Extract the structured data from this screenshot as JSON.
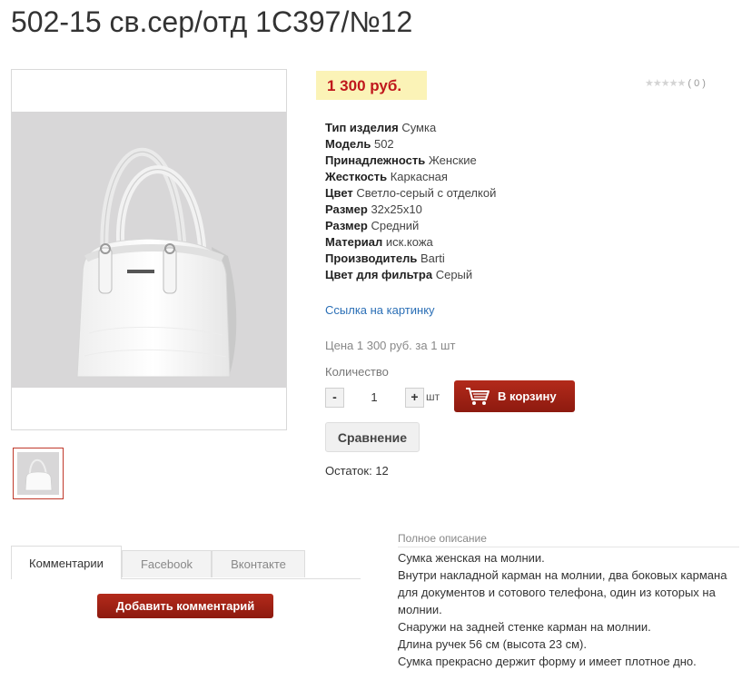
{
  "product": {
    "title": "502-15 св.сер/отд 1С397/№12",
    "price": "1 300 руб.",
    "rating": {
      "value": 0,
      "max": 5,
      "count_text": "( 0 )"
    },
    "properties": [
      {
        "name": "Тип изделия",
        "value": "Сумка"
      },
      {
        "name": "Модель",
        "value": "502"
      },
      {
        "name": "Принадлежность",
        "value": "Женские"
      },
      {
        "name": "Жесткость",
        "value": "Каркасная"
      },
      {
        "name": "Цвет",
        "value": "Светло-серый с отделкой"
      },
      {
        "name": "Размер",
        "value": "32x25x10"
      },
      {
        "name": "Размер",
        "value": "Средний"
      },
      {
        "name": "Материал",
        "value": "иск.кожа"
      },
      {
        "name": "Производитель",
        "value": "Barti"
      },
      {
        "name": "Цвет для фильтра",
        "value": "Серый"
      }
    ],
    "image_link": "Ссылка на картинку",
    "unit_price": "Цена 1 300 руб. за 1 шт",
    "quantity_label": "Количество",
    "quantity_value": "1",
    "quantity_unit": "шт",
    "minus_label": "-",
    "plus_label": "+",
    "add_to_cart": "В корзину",
    "compare": "Сравнение",
    "stock": "Остаток: 12"
  },
  "tabs": {
    "comments": "Комментарии",
    "facebook": "Facebook",
    "vkontakte": "Вконтакте",
    "add_comment": "Добавить комментарий"
  },
  "description": {
    "heading": "Полное описание",
    "lines": [
      "Сумка женская на молнии.",
      "Внутри накладной карман на молнии, два боковых кармана для документов и сотового телефона, один из которых на молнии.",
      "Снаружи на задней стенке карман на молнии.",
      "Длина ручек 56 см (высота 23 см).",
      "Сумка прекрасно держит форму и имеет плотное дно."
    ]
  },
  "colors": {
    "price": "#c0171c",
    "price_bg": "#fbf3b7",
    "accent_button": "#a12417",
    "link": "#2b6fb6"
  },
  "icons": {
    "cart": "shopping-cart-icon",
    "star": "star-icon"
  }
}
